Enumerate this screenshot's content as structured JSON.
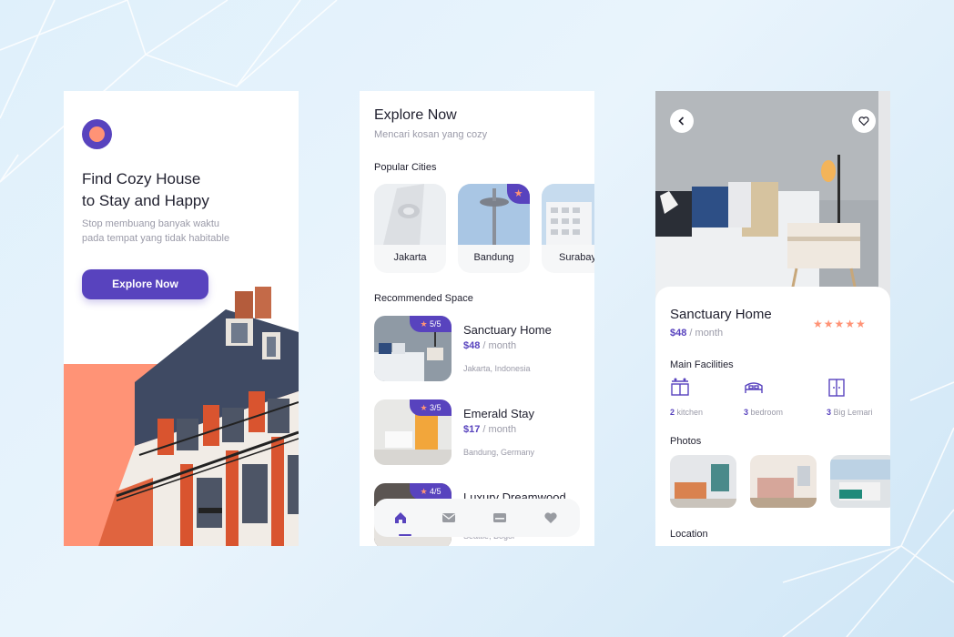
{
  "screen1": {
    "title_line1": "Find Cozy House",
    "title_line2": "to Stay and Happy",
    "subtitle_line1": "Stop membuang banyak waktu",
    "subtitle_line2": "pada tempat yang tidak habitable",
    "button": "Explore Now",
    "colors": {
      "primary": "#5843BE",
      "accent": "#FF9376"
    }
  },
  "screen2": {
    "title": "Explore Now",
    "subtitle": "Mencari kosan yang cozy",
    "popular_label": "Popular Cities",
    "cities": [
      {
        "name": "Jakarta",
        "popular": false
      },
      {
        "name": "Bandung",
        "popular": true
      },
      {
        "name": "Surabay",
        "popular": false
      }
    ],
    "recommended_label": "Recommended Space",
    "spaces": [
      {
        "rating": "5/5",
        "name": "Sanctuary Home",
        "price": "$48",
        "period": " / month",
        "location": "Jakarta, Indonesia"
      },
      {
        "rating": "3/5",
        "name": "Emerald Stay",
        "price": "$17",
        "period": " / month",
        "location": "Bandung, Germany"
      },
      {
        "rating": "4/5",
        "name": "Luxury Dreamwood",
        "price": "",
        "period": "",
        "location": "Seattle, Bogor"
      }
    ],
    "nav": [
      "home-icon",
      "mail-icon",
      "card-icon",
      "heart-icon"
    ]
  },
  "screen3": {
    "name": "Sanctuary Home",
    "price": "$48",
    "period": " / month",
    "stars": "★★★★★",
    "facilities_label": "Main Facilities",
    "facilities": [
      {
        "count": "2",
        "label": " kitchen"
      },
      {
        "count": "3",
        "label": " bedroom"
      },
      {
        "count": "3",
        "label": " Big Lemari"
      }
    ],
    "photos_label": "Photos",
    "location_label": "Location"
  }
}
